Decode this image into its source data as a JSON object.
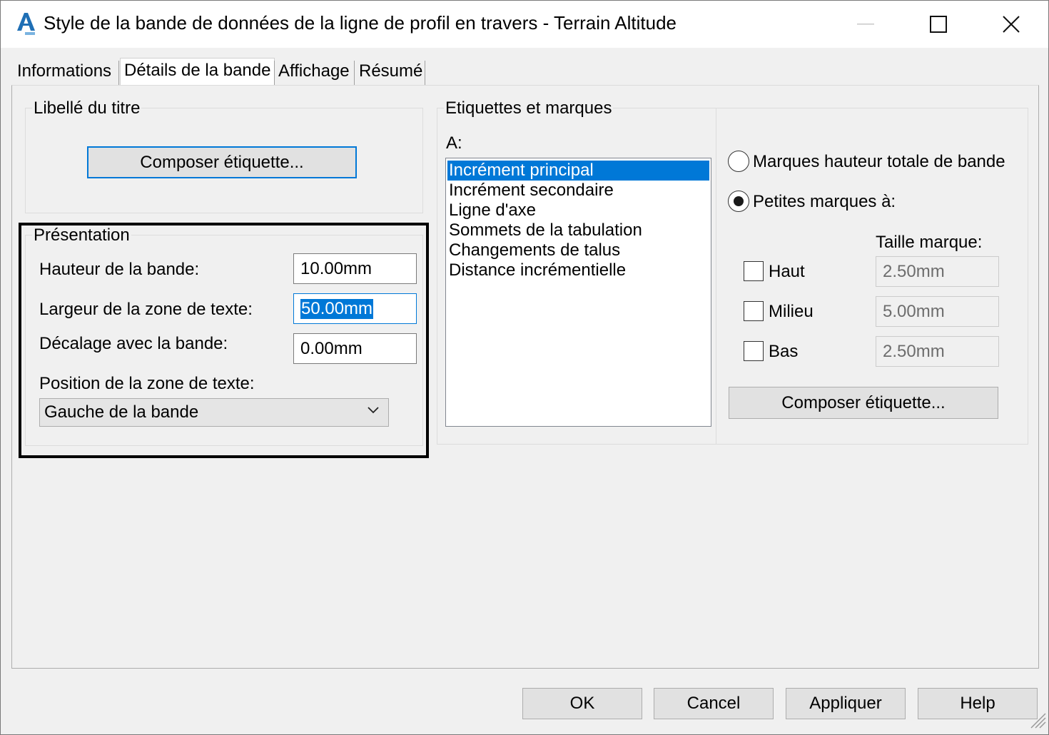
{
  "window": {
    "title": "Style de la bande de données de la ligne de profil en travers - Terrain Altitude",
    "icon": "autocad-icon"
  },
  "tabs": [
    {
      "label": "Informations",
      "active": false
    },
    {
      "label": "Détails de la bande",
      "active": true
    },
    {
      "label": "Affichage",
      "active": false
    },
    {
      "label": "Résumé",
      "active": false
    }
  ],
  "title_group": {
    "title": "Libellé du titre",
    "compose_button": "Composer étiquette..."
  },
  "presentation": {
    "title": "Présentation",
    "band_height_label": "Hauteur de la bande:",
    "band_height_value": "10.00mm",
    "text_width_label": "Largeur de la zone de texte:",
    "text_width_value": "50.00mm",
    "offset_label": "Décalage avec la bande:",
    "offset_value": "0.00mm",
    "text_position_label": "Position de la zone de texte:",
    "text_position_value": "Gauche de la bande"
  },
  "labels_ticks": {
    "title": "Etiquettes et marques",
    "at_label": "A:",
    "items": [
      "Incrément principal",
      "Incrément secondaire",
      "Ligne d'axe",
      "Sommets de la tabulation",
      "Changements de talus",
      "Distance incrémentielle"
    ],
    "selected_index": 0,
    "full_height_label": "Marques hauteur totale de bande",
    "small_ticks_label": "Petites marques à:",
    "tick_size_label": "Taille marque:",
    "top_label": "Haut",
    "top_value": "2.50mm",
    "middle_label": "Milieu",
    "middle_value": "5.00mm",
    "bottom_label": "Bas",
    "bottom_value": "2.50mm",
    "compose_button": "Composer étiquette..."
  },
  "footer": {
    "ok": "OK",
    "cancel": "Cancel",
    "apply": "Appliquer",
    "help": "Help"
  },
  "colors": {
    "accent": "#0078d7",
    "highlight_border": "#000000"
  }
}
